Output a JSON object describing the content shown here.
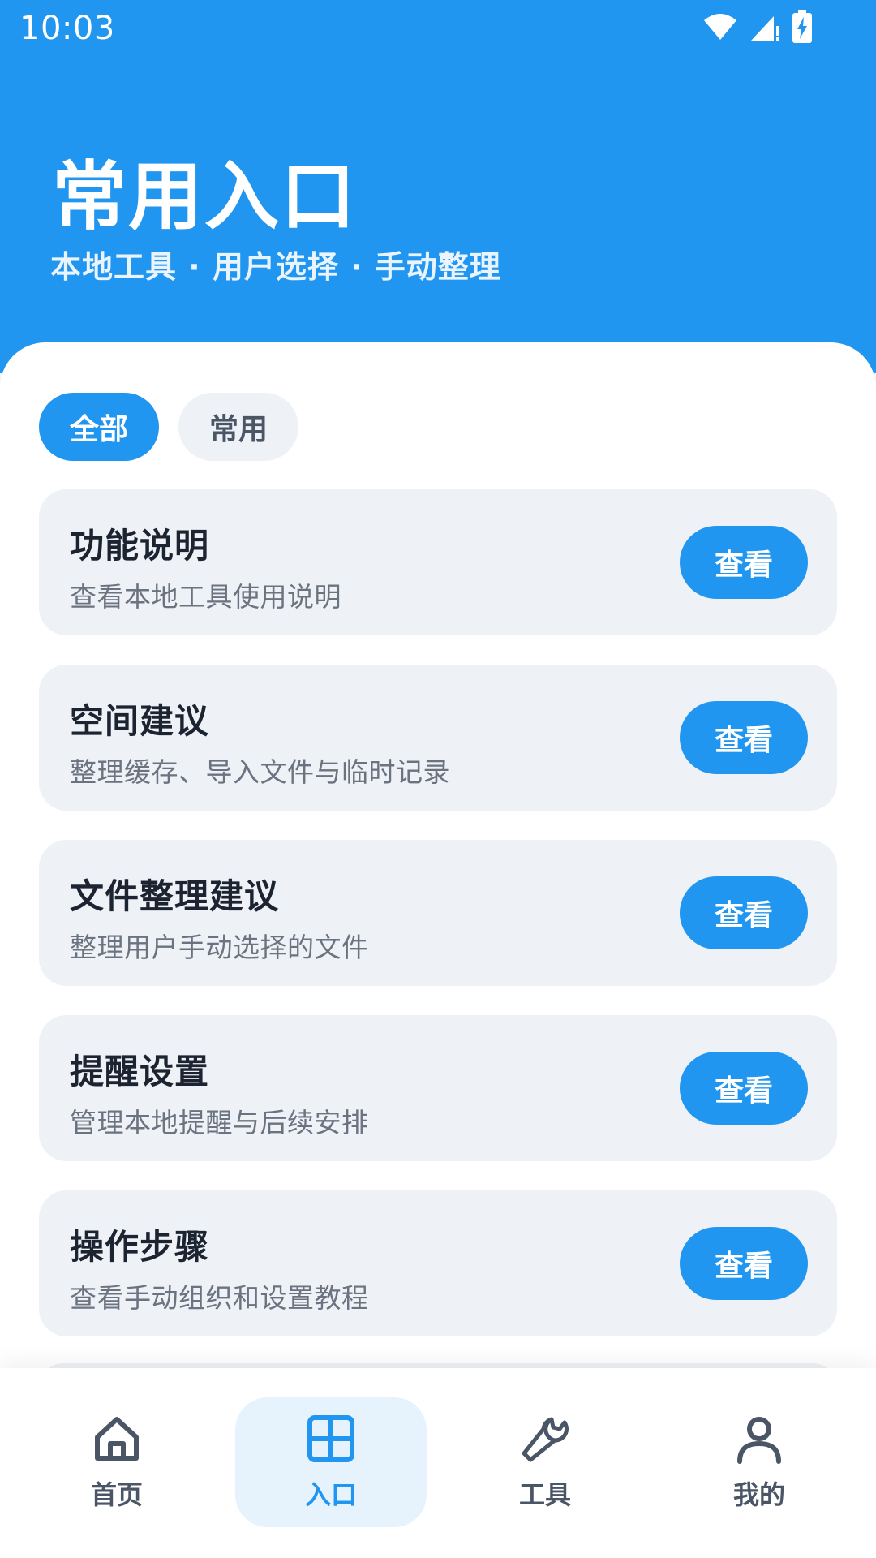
{
  "status_bar": {
    "time": "10:03"
  },
  "header": {
    "title": "常用入口",
    "subtitle": "本地工具 · 用户选择 · 手动整理"
  },
  "filters": [
    {
      "label": "全部",
      "active": true
    },
    {
      "label": "常用",
      "active": false
    }
  ],
  "cards": [
    {
      "title": "功能说明",
      "description": "查看本地工具使用说明",
      "button": "查看"
    },
    {
      "title": "空间建议",
      "description": "整理缓存、导入文件与临时记录",
      "button": "查看"
    },
    {
      "title": "文件整理建议",
      "description": "整理用户手动选择的文件",
      "button": "查看"
    },
    {
      "title": "提醒设置",
      "description": "管理本地提醒与后续安排",
      "button": "查看"
    },
    {
      "title": "操作步骤",
      "description": "查看手动组织和设置教程",
      "button": "查看"
    }
  ],
  "nav": [
    {
      "label": "首页",
      "icon": "home-icon",
      "active": false
    },
    {
      "label": "入口",
      "icon": "grid-icon",
      "active": true
    },
    {
      "label": "工具",
      "icon": "wrench-icon",
      "active": false
    },
    {
      "label": "我的",
      "icon": "person-icon",
      "active": false
    }
  ],
  "colors": {
    "accent": "#2196f0",
    "card": "#eef1f5",
    "nav_active_bg": "#e6f3fd"
  }
}
